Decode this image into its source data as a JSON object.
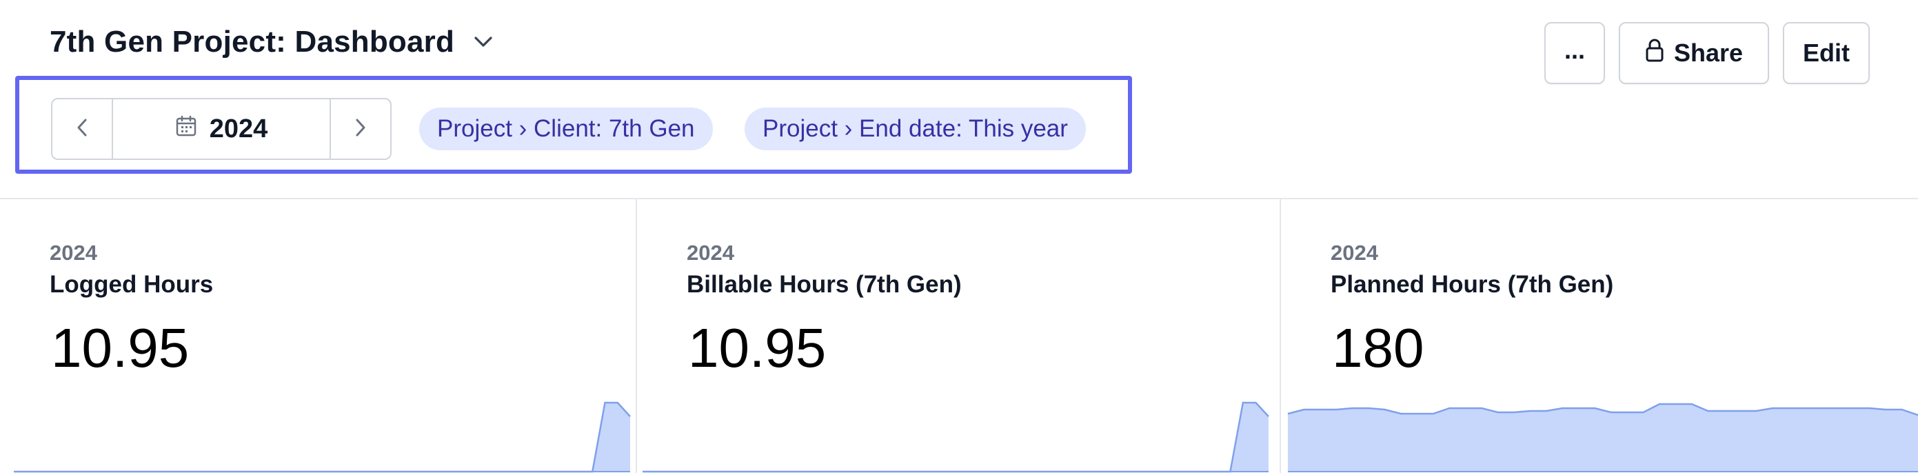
{
  "header": {
    "title": "7th Gen Project: Dashboard",
    "title_menu_icon": "chevron-down-icon"
  },
  "actions": {
    "more_label": "...",
    "share_label": "Share",
    "share_icon": "lock-icon",
    "edit_label": "Edit"
  },
  "filters": {
    "prev_icon": "chevron-left-icon",
    "next_icon": "chevron-right-icon",
    "date_icon": "calendar-icon",
    "date_value": "2024",
    "chips": [
      {
        "label": "Project › Client: 7th Gen"
      },
      {
        "label": "Project › End date: This year"
      }
    ]
  },
  "colors": {
    "accent": "#6366f1",
    "chip_bg": "#e0e7ff",
    "chip_text": "#3730a3",
    "spark_fill": "#c7d7fb",
    "spark_stroke": "#7ea0ec"
  },
  "cards": [
    {
      "eyebrow": "2024",
      "title": "Logged Hours",
      "value": "10.95",
      "spark": [
        0,
        0,
        0,
        0,
        0,
        0,
        0,
        0,
        0,
        0,
        0,
        0,
        0,
        0,
        0,
        0,
        0,
        0,
        0,
        0,
        0,
        0,
        0,
        0,
        0,
        0,
        0,
        0,
        0,
        0,
        0,
        0,
        0,
        0,
        0,
        0,
        0,
        0,
        0,
        0,
        0,
        0,
        0,
        0,
        0,
        0,
        0,
        1,
        1,
        0.8
      ]
    },
    {
      "eyebrow": "2024",
      "title": "Billable Hours (7th Gen)",
      "value": "10.95",
      "spark": [
        0,
        0,
        0,
        0,
        0,
        0,
        0,
        0,
        0,
        0,
        0,
        0,
        0,
        0,
        0,
        0,
        0,
        0,
        0,
        0,
        0,
        0,
        0,
        0,
        0,
        0,
        0,
        0,
        0,
        0,
        0,
        0,
        0,
        0,
        0,
        0,
        0,
        0,
        0,
        0,
        0,
        0,
        0,
        0,
        0,
        0,
        0,
        1,
        1,
        0.8
      ]
    },
    {
      "eyebrow": "2024",
      "title": "Planned Hours (7th Gen)",
      "value": "180",
      "spark": [
        0.84,
        0.9,
        0.9,
        0.9,
        0.92,
        0.92,
        0.9,
        0.84,
        0.84,
        0.84,
        0.92,
        0.92,
        0.92,
        0.86,
        0.86,
        0.88,
        0.88,
        0.92,
        0.92,
        0.92,
        0.86,
        0.86,
        0.86,
        0.98,
        0.98,
        0.98,
        0.88,
        0.88,
        0.88,
        0.88,
        0.92,
        0.92,
        0.92,
        0.92,
        0.92,
        0.92,
        0.92,
        0.9,
        0.9,
        0.82
      ]
    }
  ]
}
